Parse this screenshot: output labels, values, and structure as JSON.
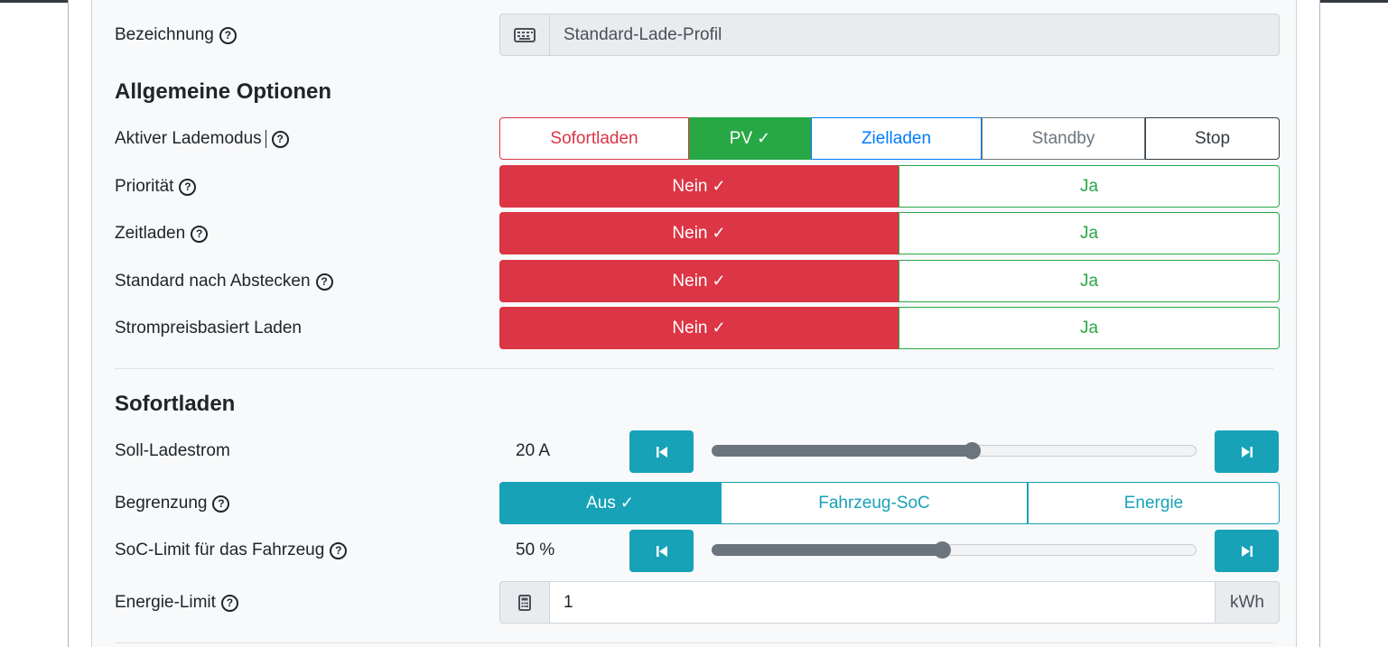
{
  "colors": {
    "danger": "#dc3545",
    "success": "#28a745",
    "primary": "#007bff",
    "secondary": "#6c757d",
    "info": "#17a2b8",
    "dark": "#343a40"
  },
  "general": {
    "name_label": "Bezeichnung",
    "name_value": "Standard-Lade-Profil",
    "name_icon": "keyboard-icon"
  },
  "allgemeine": {
    "heading": "Allgemeine Optionen",
    "mode_label": "Aktiver Lademodus",
    "modes": [
      "Sofortladen",
      "PV",
      "Zielladen",
      "Standby",
      "Stop"
    ],
    "selected_mode": "PV",
    "prioritaet_label": "Priorität",
    "zeitladen_label": "Zeitladen",
    "standard_label": "Standard nach Abstecken",
    "strompreis_label": "Strompreisbasiert Laden",
    "no_label": "Nein",
    "yes_label": "Ja"
  },
  "sofortladen": {
    "heading": "Sofortladen",
    "current_label": "Soll-Ladestrom",
    "current_value": "20 A",
    "current_slider_fraction": 0.536,
    "begrenzung_label": "Begrenzung",
    "begrenzung_options": [
      "Aus",
      "Fahrzeug-SoC",
      "Energie"
    ],
    "begrenzung_selected": "Aus",
    "soc_label": "SoC-Limit für das Fahrzeug",
    "soc_value": "50 %",
    "soc_slider_fraction": 0.474,
    "energie_label": "Energie-Limit",
    "energie_value": "1",
    "energie_unit": "kWh",
    "energie_icon": "calculator-icon"
  }
}
